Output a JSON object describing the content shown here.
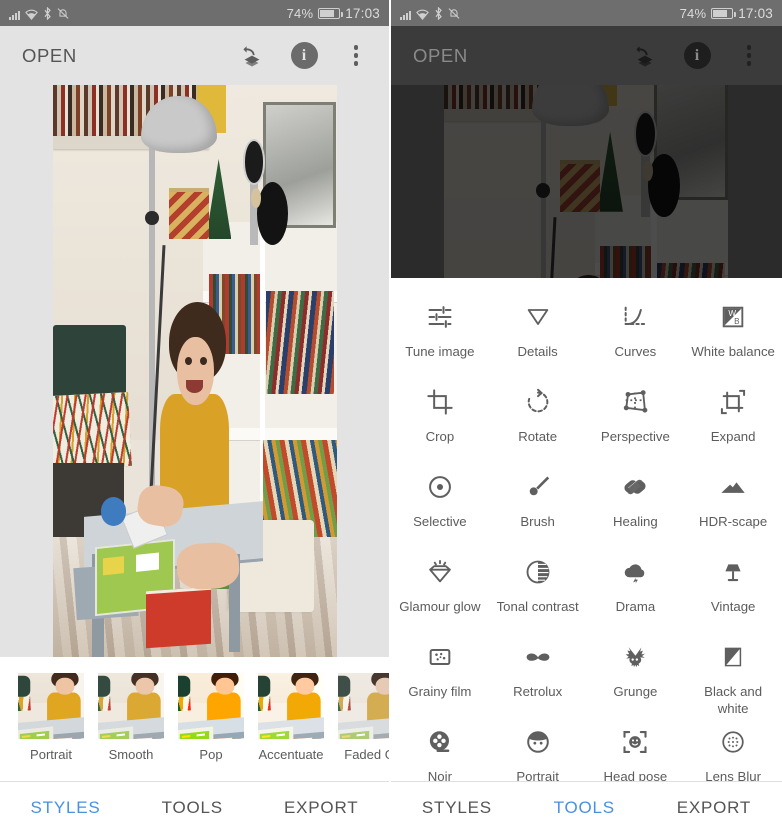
{
  "status_bar": {
    "icons": [
      "signal-icon",
      "wifi-icon",
      "bluetooth-icon",
      "mute-icon"
    ],
    "battery_percent": "74%",
    "time": "17:03"
  },
  "app_bar": {
    "title": "OPEN",
    "actions": [
      {
        "name": "edit-history-icon",
        "label": "Edit history"
      },
      {
        "name": "info-icon",
        "label": "i"
      },
      {
        "name": "overflow-menu-icon",
        "label": "More options"
      }
    ]
  },
  "colors": {
    "accent": "#4a90e2",
    "app_bar_bg": "#e3e3e3",
    "app_bar_bg_dim": "#3b3b3b",
    "status_bar_bg": "#6e6e6e",
    "icon_gray": "#5f5f5f",
    "label_gray": "#5c5c5c"
  },
  "left_panel": {
    "styles": [
      {
        "label": "Portrait"
      },
      {
        "label": "Smooth"
      },
      {
        "label": "Pop"
      },
      {
        "label": "Accentuate"
      },
      {
        "label": "Faded Gl"
      }
    ],
    "tabs": [
      {
        "label": "STYLES",
        "active": true
      },
      {
        "label": "TOOLS",
        "active": false
      },
      {
        "label": "EXPORT",
        "active": false
      }
    ]
  },
  "right_panel": {
    "tools": [
      {
        "label": "Tune image",
        "icon": "sliders-icon"
      },
      {
        "label": "Details",
        "icon": "triangle-down-icon"
      },
      {
        "label": "Curves",
        "icon": "curve-icon"
      },
      {
        "label": "White balance",
        "icon": "white-balance-icon"
      },
      {
        "label": "Crop",
        "icon": "crop-icon"
      },
      {
        "label": "Rotate",
        "icon": "rotate-icon"
      },
      {
        "label": "Perspective",
        "icon": "perspective-icon"
      },
      {
        "label": "Expand",
        "icon": "expand-icon"
      },
      {
        "label": "Selective",
        "icon": "target-dot-icon"
      },
      {
        "label": "Brush",
        "icon": "brush-icon"
      },
      {
        "label": "Healing",
        "icon": "bandage-icon"
      },
      {
        "label": "HDR-scape",
        "icon": "mountains-icon"
      },
      {
        "label": "Glamour glow",
        "icon": "gem-icon"
      },
      {
        "label": "Tonal contrast",
        "icon": "half-circle-icon"
      },
      {
        "label": "Drama",
        "icon": "storm-cloud-icon"
      },
      {
        "label": "Vintage",
        "icon": "lamp-icon"
      },
      {
        "label": "Grainy film",
        "icon": "grain-square-icon"
      },
      {
        "label": "Retrolux",
        "icon": "moustache-icon"
      },
      {
        "label": "Grunge",
        "icon": "grunge-icon"
      },
      {
        "label": "Black and white",
        "icon": "bw-triangle-icon"
      },
      {
        "label": "Noir",
        "icon": "film-reel-icon"
      },
      {
        "label": "Portrait",
        "icon": "face-icon"
      },
      {
        "label": "Head pose",
        "icon": "head-pose-icon"
      },
      {
        "label": "Lens Blur",
        "icon": "lens-blur-icon"
      }
    ],
    "tabs": [
      {
        "label": "STYLES",
        "active": false
      },
      {
        "label": "TOOLS",
        "active": true
      },
      {
        "label": "EXPORT",
        "active": false
      }
    ]
  }
}
